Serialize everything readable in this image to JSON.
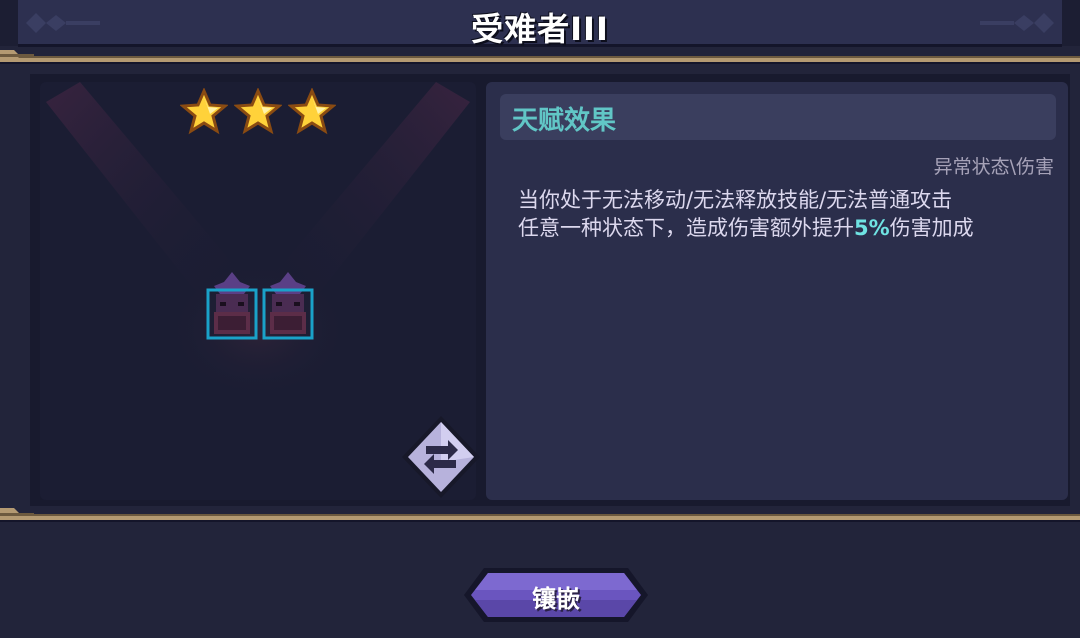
{
  "header": {
    "title": "受难者III"
  },
  "talent_card": {
    "stars": 3,
    "star_color": "#ffd23a",
    "character_icons": [
      "hooded-mage-icon",
      "hooded-mage-icon"
    ],
    "swap_icon": "swap-arrows-icon"
  },
  "talent_panel": {
    "title": "天赋效果",
    "tag": "异常状态\\伤害",
    "desc_line1": "当你处于无法移动/无法释放技能/无法普通攻击",
    "desc_line2_pre": "任意一种状态下，造成伤害额外提升",
    "desc_line2_value": "5%",
    "desc_line2_post": "伤害加成"
  },
  "actions": {
    "embed_label": "镶嵌"
  },
  "colors": {
    "accent_teal": "#61c6c6",
    "highlight": "#6fe3e3",
    "button_purple": "#6a55bf",
    "rail_gold": "#b49a72"
  }
}
